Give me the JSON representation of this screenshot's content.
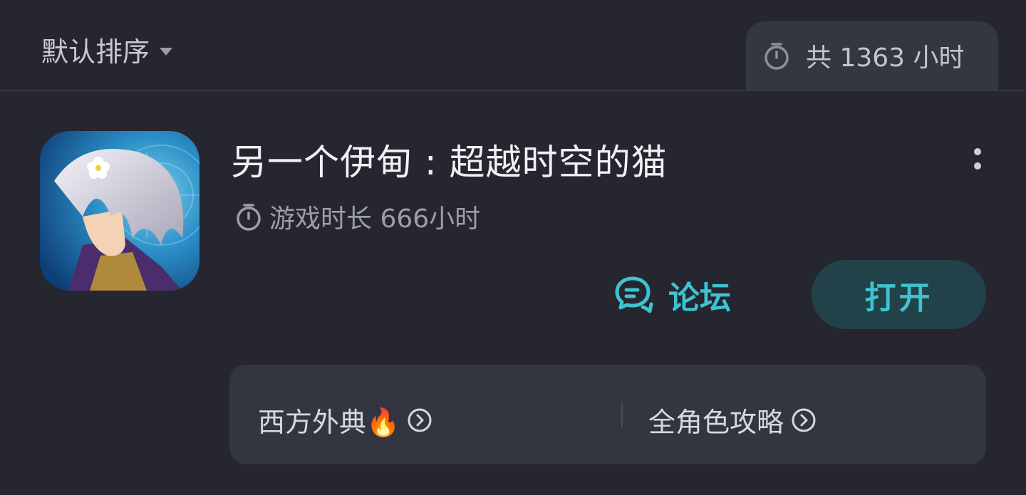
{
  "header": {
    "sort_label": "默认排序",
    "total_playtime": "共 1363 小时"
  },
  "game": {
    "title": "另一个伊甸 : 超越时空的猫",
    "playtime": "游戏时长 666小时",
    "forum_label": "论坛",
    "open_label": "打开"
  },
  "guides": [
    {
      "label": "西方外典🔥"
    },
    {
      "label": "全角色攻略"
    }
  ],
  "colors": {
    "background": "#252630",
    "card": "#333541",
    "accent": "#3ec3cf",
    "button_bg": "#224249"
  },
  "icons": {
    "timer": "stopwatch-icon",
    "forum": "chat-bubbles-icon",
    "more": "more-vertical-icon",
    "chevron": "chevron-right-circle-icon"
  }
}
